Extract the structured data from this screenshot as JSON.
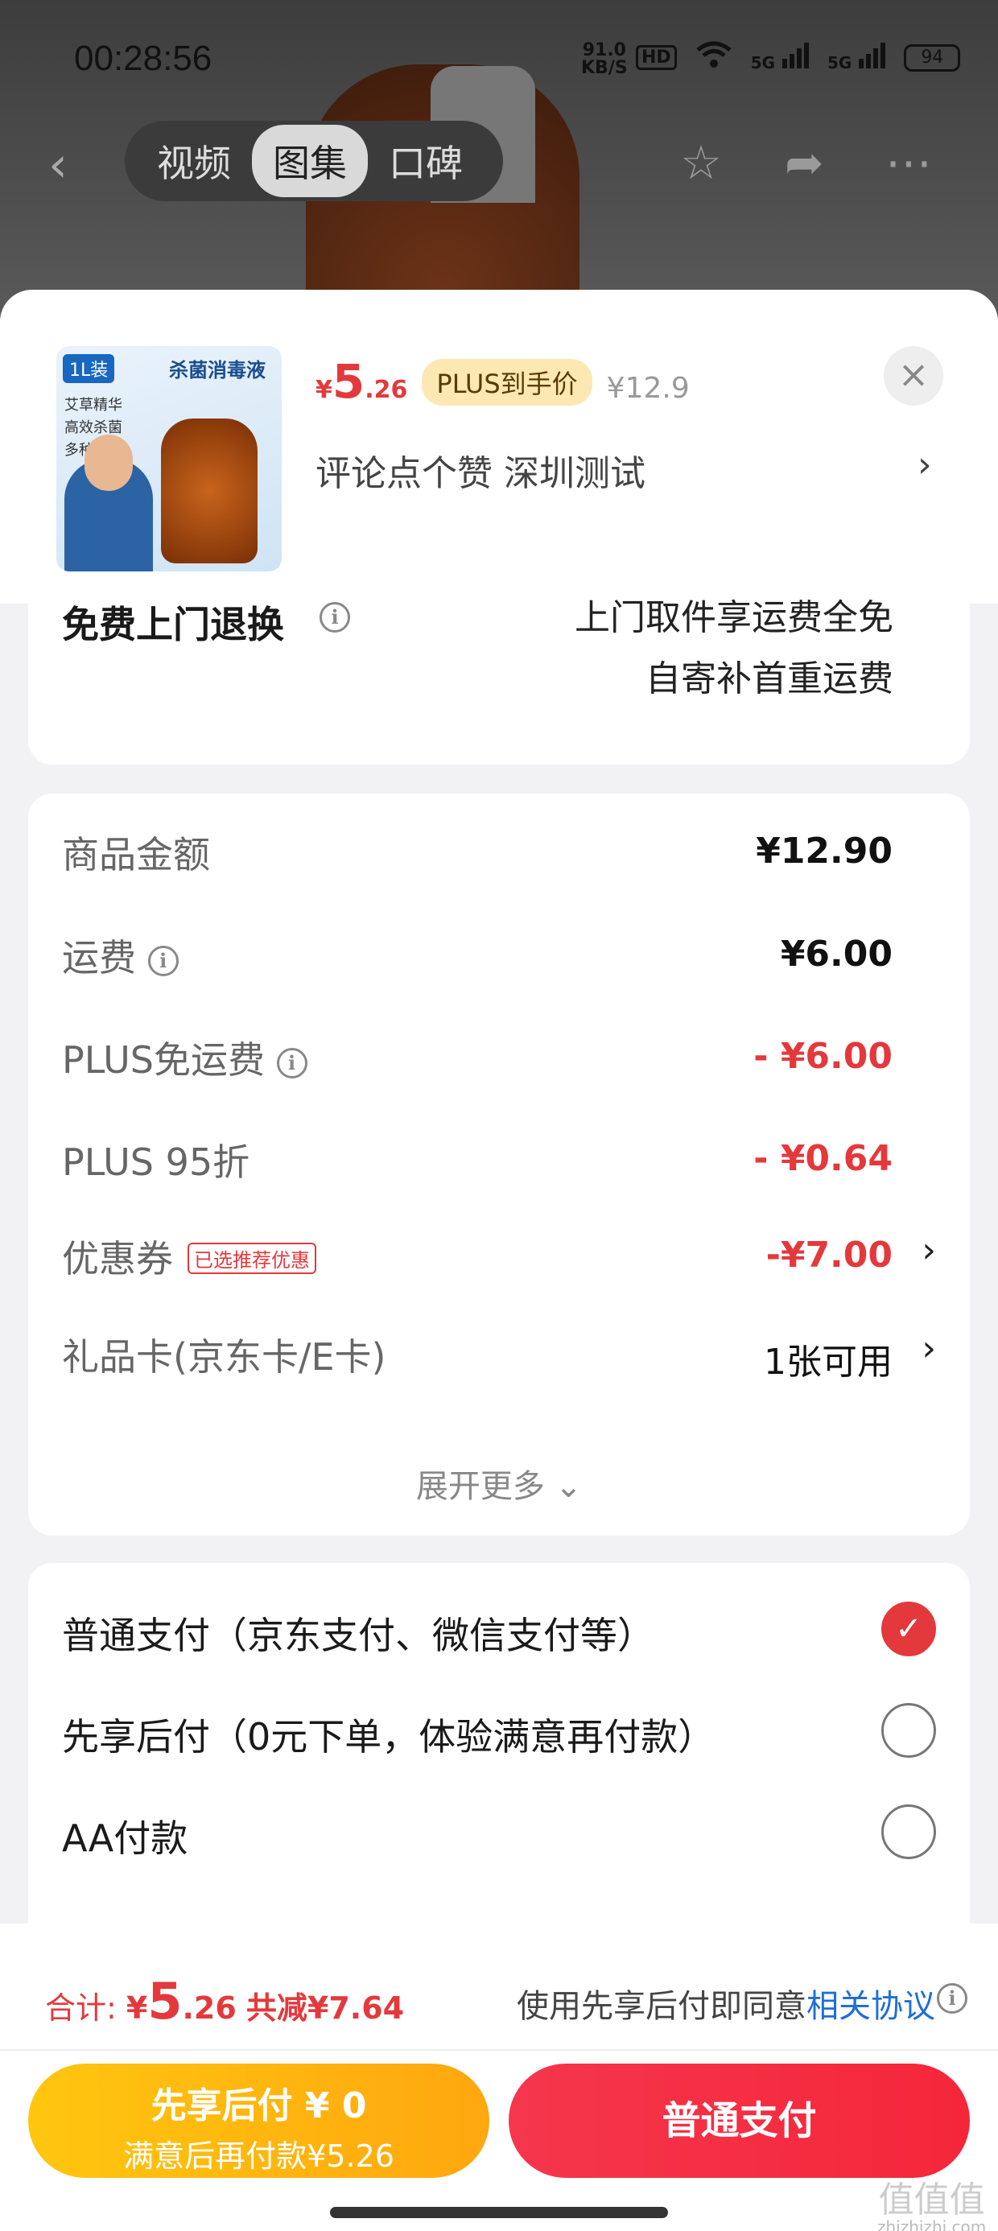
{
  "status_bar": {
    "time": "00:28:56",
    "net_speed": "91.0",
    "net_unit": "KB/S",
    "hd": "HD",
    "signal1": "5G",
    "signal2": "5G",
    "battery": "94"
  },
  "nav": {
    "tabs": [
      "视频",
      "图集",
      "口碑"
    ],
    "active_tab": "图集"
  },
  "product": {
    "image_label1": "1L装",
    "image_label2": "杀菌消毒液",
    "image_features": [
      "艾草精华",
      "高效杀菌",
      "多种用途"
    ],
    "price_symbol": "¥",
    "price_int": "5",
    "price_dec": ".26",
    "plus_badge": "PLUS到手价",
    "original_price": "¥12.9",
    "name": "评论点个赞  深圳测试"
  },
  "return_service": {
    "title": "免费上门退换",
    "line1": "上门取件享运费全免",
    "line2": "自寄补首重运费"
  },
  "fees": {
    "goods_label": "商品金额",
    "goods_value": "¥12.90",
    "shipping_label": "运费",
    "shipping_value": "¥6.00",
    "plus_free_label": "PLUS免运费",
    "plus_free_value": "- ¥6.00",
    "plus_discount_label": "PLUS 95折",
    "plus_discount_value": "- ¥0.64",
    "coupon_label": "优惠券",
    "coupon_tag": "已选推荐优惠",
    "coupon_value": "-¥7.00",
    "gift_card_label": "礼品卡(京东卡/E卡)",
    "gift_card_value": "1张可用",
    "expand_more": "展开更多"
  },
  "payment": {
    "options": [
      {
        "label": "普通支付（京东支付、微信支付等）",
        "checked": true
      },
      {
        "label": "先享后付（0元下单，体验满意再付款）",
        "checked": false
      },
      {
        "label": "AA付款",
        "checked": false
      }
    ]
  },
  "bottom_bar": {
    "total_label": "合计:",
    "total_symbol": "¥",
    "total_int": "5",
    "total_dec": ".26",
    "total_reduced": "共减¥7.64",
    "agree_text": "使用先享后付即同意",
    "agree_link": "相关协议",
    "btn_later_line1": "先享后付 ¥ 0",
    "btn_later_line2": "满意后再付款¥5.26",
    "btn_pay": "普通支付"
  },
  "watermark": {
    "text": "值值值",
    "site": "zhizhizhi.com"
  },
  "colors": {
    "accent_red": "#e4393c",
    "plus_gold": "#fde8b4",
    "pay_later_yellow": "#ffb60f",
    "link_blue": "#1f6fd6"
  }
}
